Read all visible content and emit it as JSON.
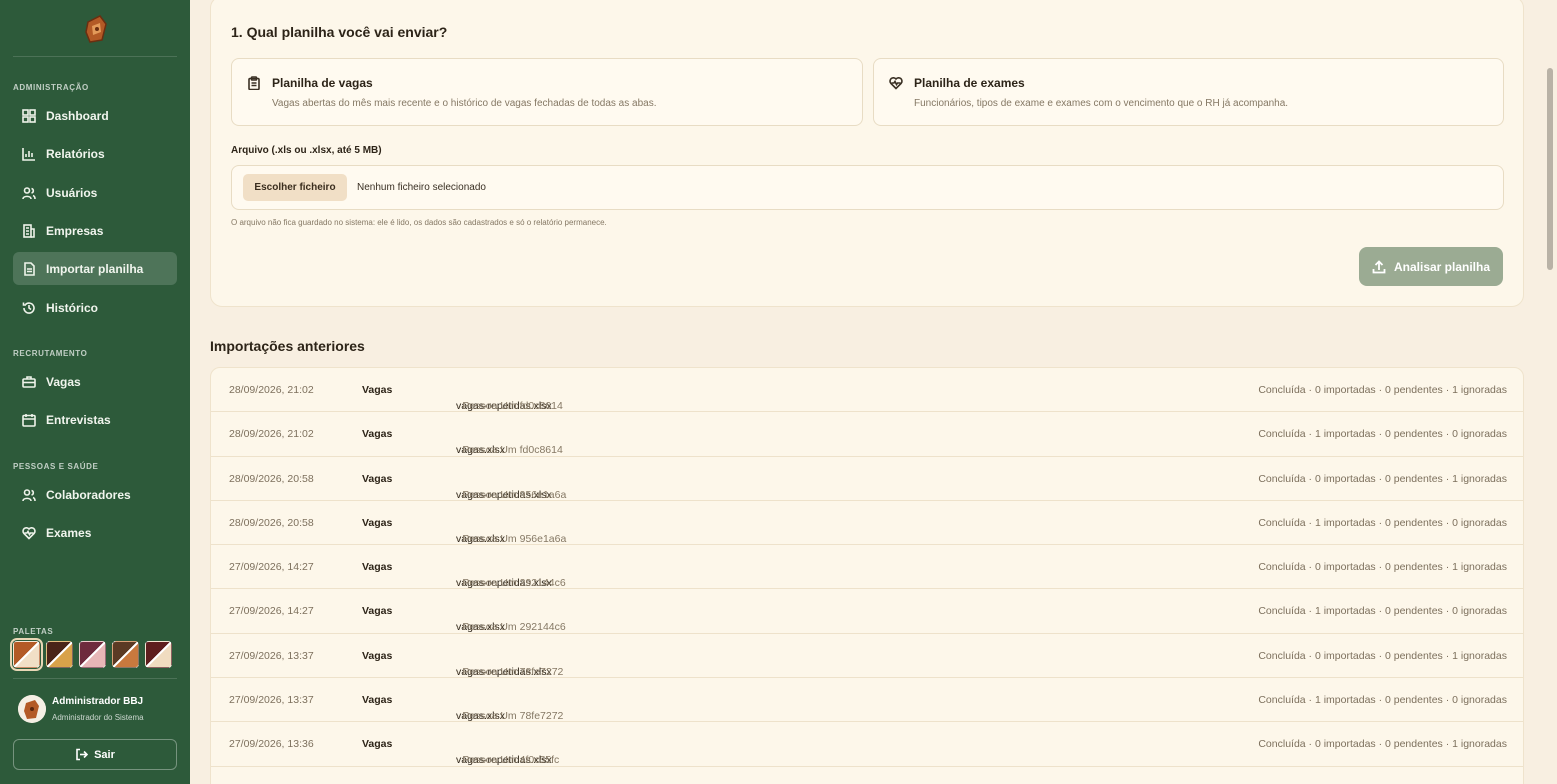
{
  "colors": {
    "sidebar": "#2d5a3a",
    "page": "#f8efe1",
    "analyze_button": "#9bab93"
  },
  "sidebar": {
    "sections": [
      {
        "label": "ADMINISTRAÇÃO"
      },
      {
        "label": "RECRUTAMENTO"
      },
      {
        "label": "PESSOAS E SAÚDE"
      }
    ],
    "items": [
      {
        "label": "Dashboard",
        "icon": "dashboard-icon"
      },
      {
        "label": "Relatórios",
        "icon": "chart-icon"
      },
      {
        "label": "Usuários",
        "icon": "users-icon"
      },
      {
        "label": "Empresas",
        "icon": "building-icon"
      },
      {
        "label": "Importar planilha",
        "icon": "file-icon",
        "active": true
      },
      {
        "label": "Histórico",
        "icon": "history-icon"
      },
      {
        "label": "Vagas",
        "icon": "briefcase-icon"
      },
      {
        "label": "Entrevistas",
        "icon": "calendar-icon"
      },
      {
        "label": "Colaboradores",
        "icon": "users-icon"
      },
      {
        "label": "Exames",
        "icon": "heart-pulse-icon"
      }
    ],
    "palettes_label": "PALETAS",
    "palettes": [
      {
        "a": "#b35a26",
        "b": "#f1dfc6"
      },
      {
        "a": "#4a2418",
        "b": "#d9a24a"
      },
      {
        "a": "#6e2b3d",
        "b": "#e7b6b6"
      },
      {
        "a": "#5b3a24",
        "b": "#c9793e"
      },
      {
        "a": "#5e1e1e",
        "b": "#f0dcc0"
      }
    ],
    "user": {
      "name": "Administrador BBJ",
      "role": "Administrador do Sistema"
    },
    "logout_label": "Sair"
  },
  "upload": {
    "question": "1. Qual planilha você vai enviar?",
    "options": [
      {
        "title": "Planilha de vagas",
        "description": "Vagas abertas do mês mais recente e o histórico de vagas fechadas de todas as abas.",
        "icon": "clipboard-icon"
      },
      {
        "title": "Planilha de exames",
        "description": "Funcionários, tipos de exame e exames com o vencimento que o RH já acompanha.",
        "icon": "heart-pulse-icon"
      }
    ],
    "file_label": "Arquivo (.xls ou .xlsx, até 5 MB)",
    "choose_button": "Escolher ficheiro",
    "no_file": "Nenhum ficheiro selecionado",
    "note": "O arquivo não fica guardado no sistema: ele é lido, os dados são cadastrados e só o relatório permanece.",
    "analyze_button": "Analisar planilha"
  },
  "history": {
    "title": "Importações anteriores",
    "rows": [
      {
        "date": "28/09/2026, 21:02",
        "type": "Vagas",
        "file": "vagas-repetidas.xlsx",
        "who": " · Pessoa Um fd0c8614",
        "status": "Concluída · 0 importadas · 0 pendentes · 1 ignoradas"
      },
      {
        "date": "28/09/2026, 21:02",
        "type": "Vagas",
        "file": "vagas.xlsx",
        "who": " · Pessoa Um fd0c8614",
        "status": "Concluída · 1 importadas · 0 pendentes · 0 ignoradas"
      },
      {
        "date": "28/09/2026, 20:58",
        "type": "Vagas",
        "file": "vagas-repetidas.xlsx",
        "who": " · Pessoa Um 956e1a6a",
        "status": "Concluída · 0 importadas · 0 pendentes · 1 ignoradas"
      },
      {
        "date": "28/09/2026, 20:58",
        "type": "Vagas",
        "file": "vagas.xlsx",
        "who": " · Pessoa Um 956e1a6a",
        "status": "Concluída · 1 importadas · 0 pendentes · 0 ignoradas"
      },
      {
        "date": "27/09/2026, 14:27",
        "type": "Vagas",
        "file": "vagas-repetidas.xlsx",
        "who": " · Pessoa Um 292144c6",
        "status": "Concluída · 0 importadas · 0 pendentes · 1 ignoradas"
      },
      {
        "date": "27/09/2026, 14:27",
        "type": "Vagas",
        "file": "vagas.xlsx",
        "who": " · Pessoa Um 292144c6",
        "status": "Concluída · 1 importadas · 0 pendentes · 0 ignoradas"
      },
      {
        "date": "27/09/2026, 13:37",
        "type": "Vagas",
        "file": "vagas-repetidas.xlsx",
        "who": " · Pessoa Um 78fe7272",
        "status": "Concluída · 0 importadas · 0 pendentes · 1 ignoradas"
      },
      {
        "date": "27/09/2026, 13:37",
        "type": "Vagas",
        "file": "vagas.xlsx",
        "who": " · Pessoa Um 78fe7272",
        "status": "Concluída · 1 importadas · 0 pendentes · 0 ignoradas"
      },
      {
        "date": "27/09/2026, 13:36",
        "type": "Vagas",
        "file": "vagas-repetidas.xlsx",
        "who": " · Pessoa Um 4f0c55fc",
        "status": "Concluída · 0 importadas · 0 pendentes · 1 ignoradas"
      }
    ]
  }
}
